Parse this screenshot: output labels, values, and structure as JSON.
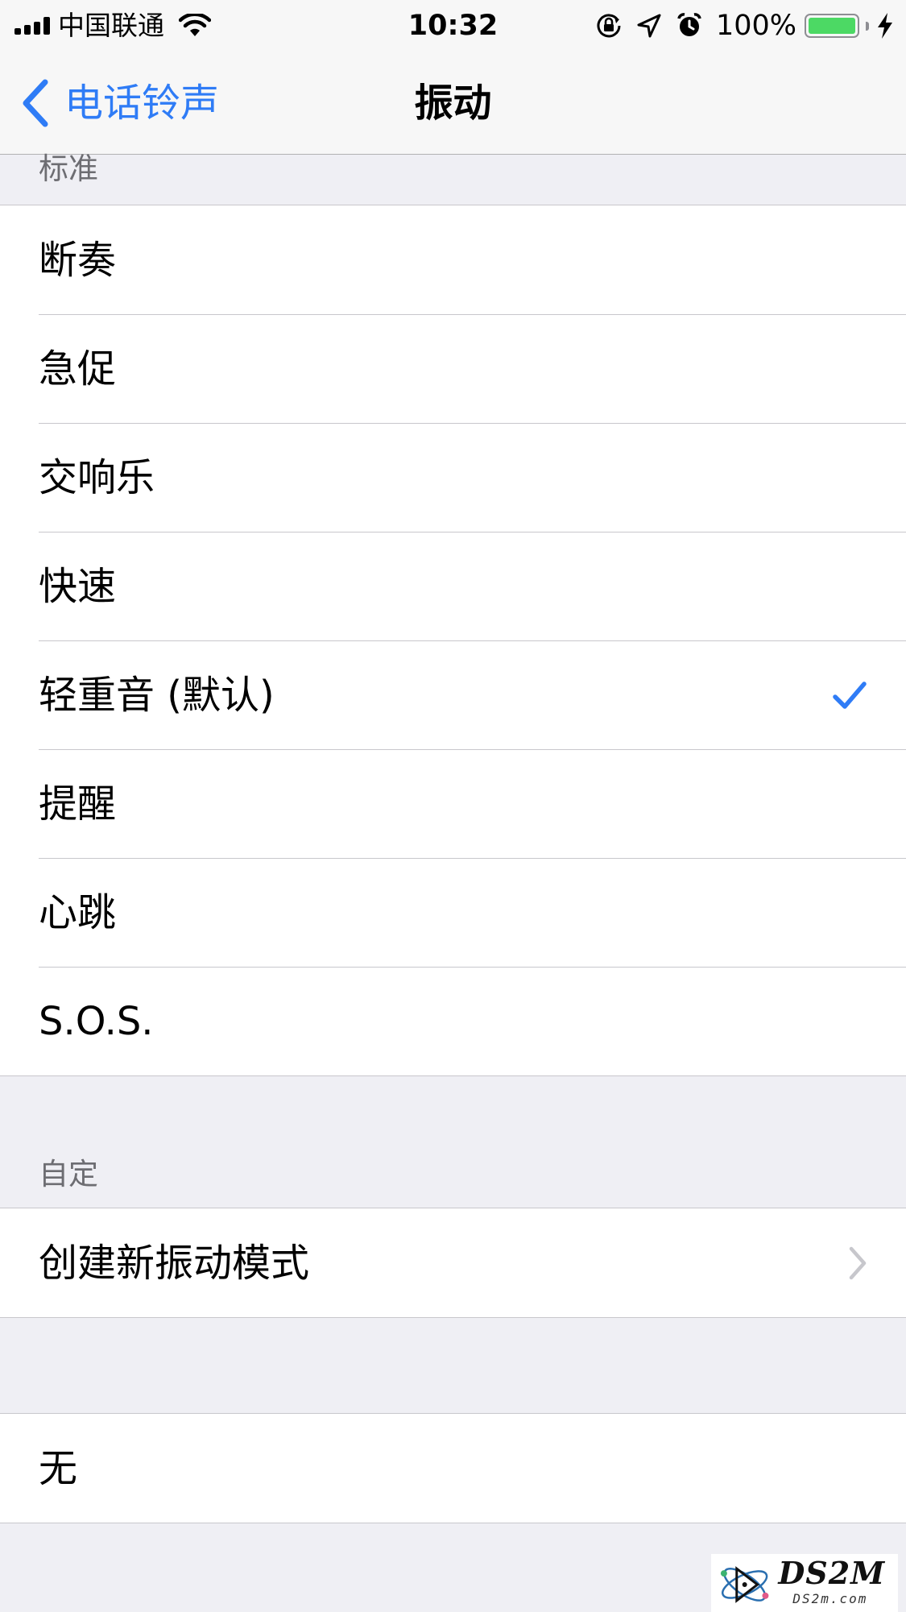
{
  "status_bar": {
    "carrier": "中国联通",
    "time": "10:32",
    "battery_percent": "100%",
    "battery_level": 1.0,
    "icons": [
      "signal-icon",
      "wifi-icon",
      "orientation-lock-icon",
      "location-icon",
      "alarm-icon",
      "battery-icon",
      "charging-icon"
    ]
  },
  "nav": {
    "back_label": "电话铃声",
    "title": "振动"
  },
  "standard": {
    "header": "标准",
    "items": [
      {
        "label": "断奏"
      },
      {
        "label": "急促"
      },
      {
        "label": "交响乐"
      },
      {
        "label": "快速"
      },
      {
        "label": "轻重音 (默认)"
      },
      {
        "label": "提醒"
      },
      {
        "label": "心跳"
      },
      {
        "label": "S.O.S."
      }
    ],
    "selected_index": 4
  },
  "custom": {
    "header": "自定",
    "create_label": "创建新振动模式"
  },
  "none_group": {
    "label": "无"
  },
  "watermark": {
    "brand": "DS2M",
    "domain": "DS2m.com"
  },
  "colors": {
    "accent": "#2f7cf6",
    "battery_fill": "#4cd964",
    "background": "#efeff4",
    "separator": "#c8c7cc",
    "header_text": "#6d6d72"
  }
}
